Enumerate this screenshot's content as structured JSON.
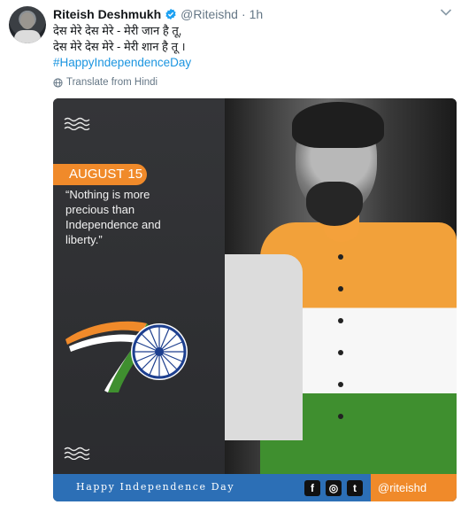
{
  "tweet": {
    "author_name": "Riteish Deshmukh",
    "author_handle": "@Riteishd",
    "separator": "·",
    "time": "1h",
    "text_line_1": "देस मेरे देस मेरे - मेरी जान है तू,",
    "text_line_2": "देस मेरे देस मेरे - मेरी शान है तू ।",
    "hashtag": "#HappyIndependenceDay",
    "translate_label": "Translate from Hindi"
  },
  "media": {
    "date_badge": "AUGUST 15",
    "quote_lines": [
      "“Nothing is more",
      "precious than",
      "Independence and",
      "liberty.”"
    ],
    "big_numeral_glyph": "7",
    "footer_text": "Happy Independence Day",
    "social_icons": [
      "facebook-icon",
      "instagram-icon",
      "twitter-icon"
    ],
    "social_glyphs": [
      "f",
      "◎",
      "t"
    ],
    "handle_text": "@riteishd"
  },
  "colors": {
    "link": "#1b95e0",
    "saffron": "#f08a2a",
    "green": "#3f8f2f",
    "chakra_blue": "#1d3f8f",
    "footer_blue": "#2c6fb6"
  }
}
